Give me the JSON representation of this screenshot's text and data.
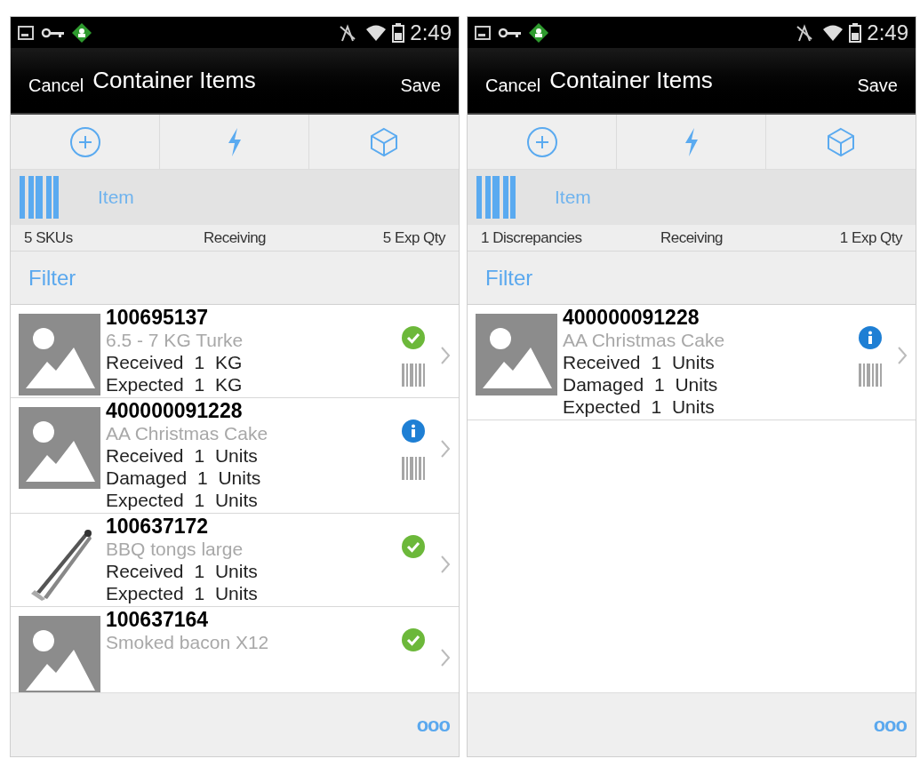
{
  "screens": [
    {
      "status_bar": {
        "time": "2:49"
      },
      "header": {
        "cancel": "Cancel",
        "title": "Container Items",
        "save": "Save"
      },
      "scan": {
        "label": "Item"
      },
      "summary": {
        "left": "5 SKUs",
        "center": "Receiving",
        "right": "5 Exp Qty"
      },
      "filter": "Filter",
      "items": [
        {
          "id": "100695137",
          "name": "6.5 - 7 KG Turke",
          "kind": "placeholder",
          "discrepancy": false,
          "barcode": true,
          "lines": [
            "Received 1 KG",
            "Expected 1 KG"
          ]
        },
        {
          "id": "400000091228",
          "name": "AA Christmas Cake",
          "kind": "placeholder",
          "discrepancy": true,
          "barcode": true,
          "lines": [
            "Received 1 Units",
            "Damaged 1 Units",
            "Expected 1 Units"
          ]
        },
        {
          "id": "100637172",
          "name": "BBQ tongs large",
          "kind": "picture",
          "discrepancy": false,
          "barcode": false,
          "lines": [
            "Received 1 Units",
            "Expected 1 Units"
          ]
        },
        {
          "id": "100637164",
          "name": "Smoked bacon X12",
          "kind": "placeholder",
          "discrepancy": false,
          "barcode": false
        }
      ],
      "more": "ooo"
    },
    {
      "status_bar": {
        "time": "2:49"
      },
      "header": {
        "cancel": "Cancel",
        "title": "Container Items",
        "save": "Save"
      },
      "scan": {
        "label": "Item"
      },
      "summary": {
        "left": "1 Discrepancies",
        "center": "Receiving",
        "right": "1 Exp Qty"
      },
      "filter": "Filter",
      "items": [
        {
          "id": "400000091228",
          "name": "AA Christmas Cake",
          "kind": "placeholder",
          "discrepancy": true,
          "barcode": true,
          "lines": [
            "Received 1 Units",
            "Damaged 1 Units",
            "Expected 1 Units"
          ]
        }
      ],
      "more": "ooo"
    }
  ]
}
